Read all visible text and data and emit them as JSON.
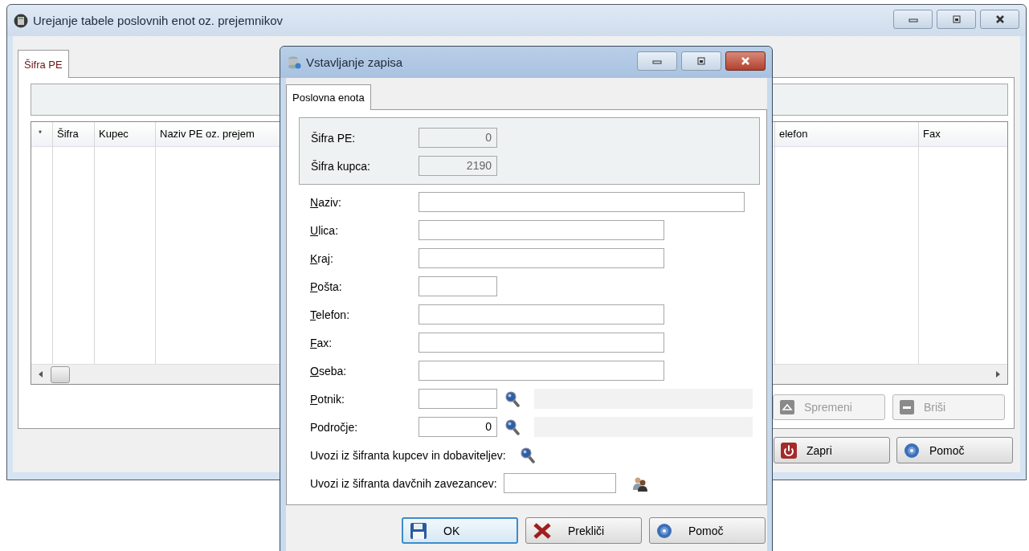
{
  "main_window": {
    "title": "Urejanje tabele poslovnih enot oz. prejemnikov",
    "tabs": [
      {
        "label": "Šifra PE",
        "selected": true
      }
    ],
    "table": {
      "columns": [
        "*",
        "Šifra",
        "Kupec",
        "Naziv PE oz. prejem",
        "elefon",
        "Fax"
      ]
    },
    "row_buttons": [
      {
        "label": "Spremeni",
        "kind": "edit",
        "disabled": true
      },
      {
        "label": "Briši",
        "kind": "delete",
        "disabled": true
      }
    ],
    "buttons": [
      {
        "label": "Zapri",
        "kind": "close"
      },
      {
        "label": "Pomoč",
        "kind": "help"
      }
    ]
  },
  "dialog": {
    "title": "Vstavljanje zapisa",
    "tabs": [
      {
        "label": "Poslovna enota",
        "selected": true
      }
    ],
    "readonly_fields": [
      {
        "label": "Šifra PE:",
        "value": "0"
      },
      {
        "label": "Šifra kupca:",
        "value": "2190"
      }
    ],
    "fields": [
      {
        "label": "Naziv:",
        "mnemonic": true,
        "kind": "wide"
      },
      {
        "label": "Ulica:",
        "mnemonic": true,
        "kind": "medium"
      },
      {
        "label": "Kraj:",
        "mnemonic": true,
        "kind": "medium"
      },
      {
        "label": "Pošta:",
        "mnemonic": true,
        "kind": "short"
      },
      {
        "label": "Telefon:",
        "mnemonic": true,
        "kind": "medium"
      },
      {
        "label": "Fax:",
        "mnemonic": true,
        "kind": "medium"
      },
      {
        "label": "Oseba:",
        "mnemonic": true,
        "kind": "medium"
      },
      {
        "label": "Potnik:",
        "mnemonic": true,
        "kind": "lookup"
      },
      {
        "label": "Področje:",
        "mnemonic": false,
        "kind": "lookup",
        "value": "0"
      }
    ],
    "imports": [
      {
        "label": "Uvozi iz šifranta kupcev in dobaviteljev:",
        "kind": "search"
      },
      {
        "label": "Uvozi iz šifranta davčnih zavezancev:",
        "kind": "taxpayer"
      }
    ],
    "buttons": [
      {
        "label": "OK",
        "kind": "save",
        "focused": true
      },
      {
        "label": "Prekliči",
        "kind": "cancel",
        "focused": false
      },
      {
        "label": "Pomoč",
        "kind": "help",
        "focused": false
      }
    ]
  }
}
